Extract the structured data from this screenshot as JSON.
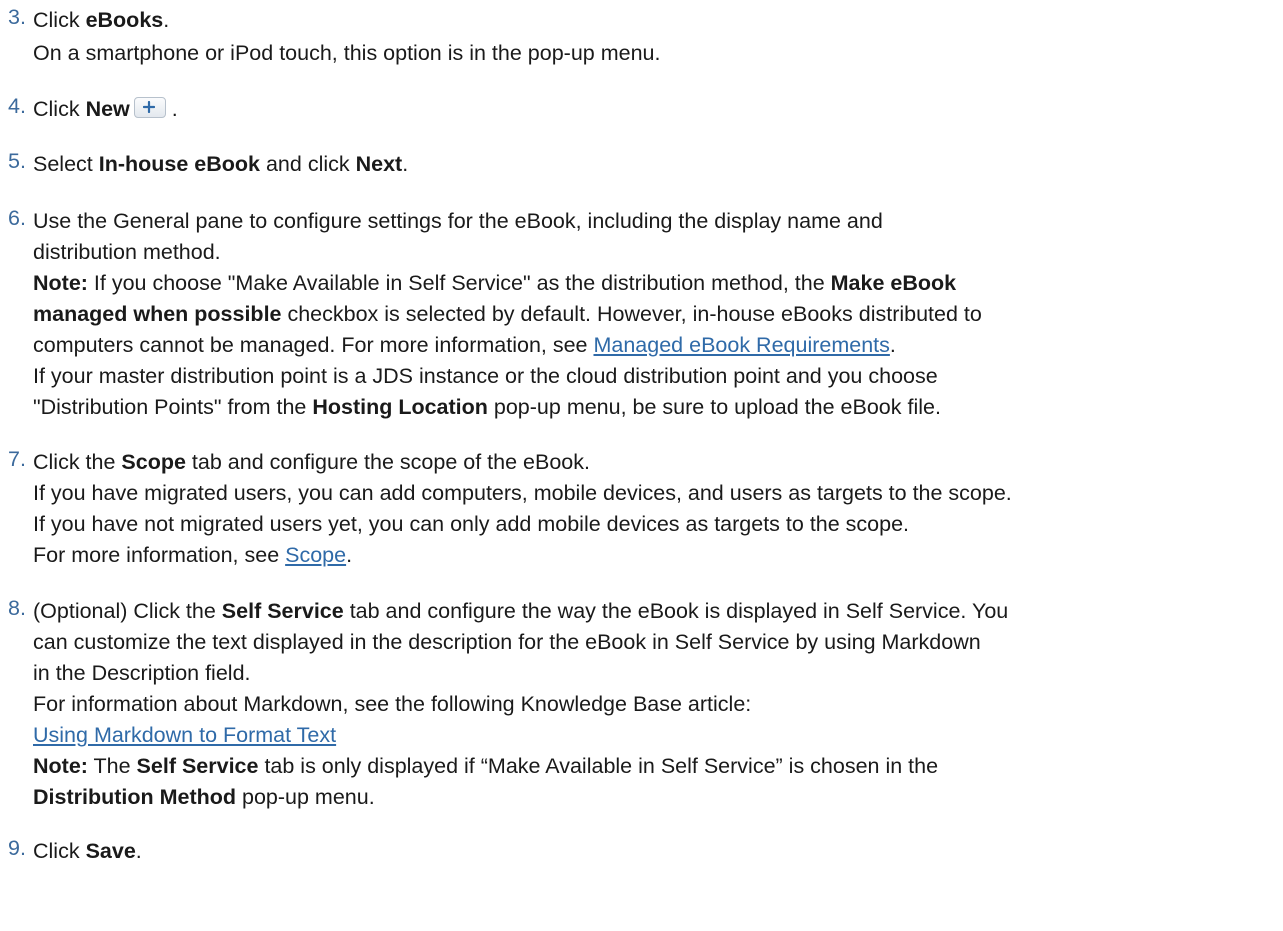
{
  "steps": [
    {
      "number": "3.",
      "lines": [
        {
          "t1": "Click ",
          "b1": "eBooks",
          "t2": "."
        },
        {
          "t1": "On a smartphone or iPod touch, this option is in the pop-up menu."
        }
      ]
    },
    {
      "number": "4.",
      "lines": [
        {
          "t1": "Click ",
          "b1": "New",
          "t2": " ."
        }
      ]
    },
    {
      "number": "5.",
      "lines": [
        {
          "t1": "Select ",
          "b1": "In-house eBook",
          "t2": " and click ",
          "b2": "Next",
          "t3": "."
        }
      ]
    },
    {
      "number": "6.",
      "lines": [
        {
          "t1": "Use the General pane to configure settings for the eBook, including the display name and"
        },
        {
          "t1": "distribution method."
        },
        {
          "b1": "Note:",
          "t1": " If you choose \"Make Available in Self Service\" as the distribution method, the ",
          "b2": "Make eBook"
        },
        {
          "b1": "managed when possible",
          "t1": " checkbox is selected by default. However, in-house eBooks distributed to"
        },
        {
          "t1": "computers cannot be managed. For more information, see ",
          "link": "Managed eBook Requirements",
          "t2": "."
        },
        {
          "t1": "If your master distribution point is a JDS instance or the cloud distribution point and you choose"
        },
        {
          "t1": "\"Distribution Points\" from the ",
          "b1": "Hosting Location",
          "t2": " pop-up menu, be sure to upload the eBook file."
        }
      ]
    },
    {
      "number": "7.",
      "lines": [
        {
          "t1": "Click the ",
          "b1": "Scope",
          "t2": " tab and configure the scope of the eBook."
        },
        {
          "t1": "If you have migrated users, you can add computers, mobile devices, and users as targets to the scope."
        },
        {
          "t1": "If you have not migrated users yet, you can only add mobile devices as targets to the scope."
        },
        {
          "t1": "For more information, see ",
          "link": "Scope",
          "t2": "."
        }
      ]
    },
    {
      "number": "8.",
      "lines": [
        {
          "t1": "(Optional) Click the ",
          "b1": "Self Service",
          "t2": " tab and configure the way the eBook is displayed in Self Service. You"
        },
        {
          "t1": "can customize the text displayed in the description for the eBook in Self Service by using Markdown"
        },
        {
          "t1": "in the Description field."
        },
        {
          "t1": "For information about Markdown, see the following Knowledge Base article:"
        },
        {
          "link": "Using Markdown to Format Text"
        },
        {
          "b1": "Note:",
          "t1": " The ",
          "b2": "Self Service",
          "t2": " tab is only displayed if “Make Available in Self Service” is chosen in the"
        },
        {
          "b1": "Distribution Method",
          "t1": " pop-up menu."
        }
      ]
    },
    {
      "number": "9.",
      "lines": [
        {
          "t1": "Click ",
          "b1": "Save",
          "t2": "."
        }
      ]
    }
  ]
}
